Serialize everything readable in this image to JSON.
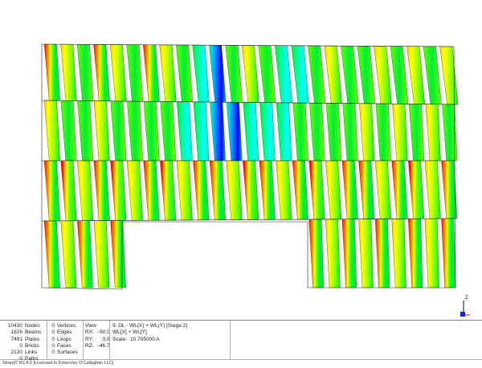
{
  "app": {
    "credits": "Strand7 R2.4.5 [Licensed to Eckersley O'Callaghan LLC]"
  },
  "status": {
    "entity_counts": [
      {
        "value": "10430",
        "label": "Nodes"
      },
      {
        "value": "1826",
        "label": "Beams"
      },
      {
        "value": "7491",
        "label": "Plates"
      },
      {
        "value": "0",
        "label": "Bricks"
      },
      {
        "value": "2130",
        "label": "Links"
      },
      {
        "value": "0",
        "label": "Paths"
      }
    ],
    "geometry_counts": [
      {
        "value": "0",
        "label": "Vertices"
      },
      {
        "value": "0",
        "label": "Edges"
      },
      {
        "value": "0",
        "label": "Loops"
      },
      {
        "value": "0",
        "label": "Faces"
      },
      {
        "value": "0",
        "label": "Surfaces"
      }
    ],
    "view": {
      "title": "View",
      "rotations": [
        {
          "label": "RX:",
          "value": "-90.0"
        },
        {
          "label": "RY:",
          "value": "0.0"
        },
        {
          "label": "RZ:",
          "value": "-46.7"
        }
      ]
    },
    "result": {
      "case": "9: DL - WL(X) + WL(Y) [Stage 2]",
      "combo": "WL[X] + WL[Y]",
      "scale_label": "Scale:",
      "scale_value": "10.705000 A"
    }
  },
  "axis": {
    "z_label": "Z",
    "colors": {
      "z": "#111111",
      "y": "#1a1aff",
      "x": "#ff2020"
    }
  },
  "colormap": [
    "#ff0000",
    "#ff5500",
    "#ff9900",
    "#ffcc00",
    "#ffff00",
    "#bbff00",
    "#66ff00",
    "#00ee33",
    "#00ff99",
    "#00ffff",
    "#00bbff",
    "#0066ff",
    "#0000ff",
    "#ff00aa"
  ]
}
